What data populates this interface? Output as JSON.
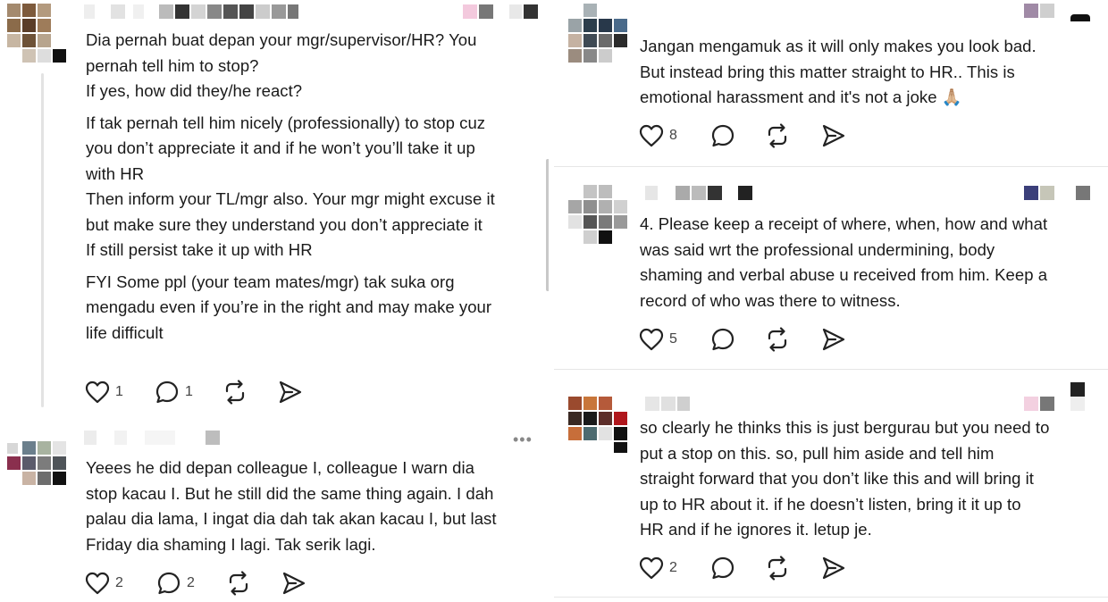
{
  "left": {
    "post1": {
      "lines": [
        "Dia pernah buat depan your mgr/supervisor/HR? You",
        "pernah tell him to stop?",
        "If yes, how did they/he react?",
        "If tak pernah tell him nicely (professionally) to stop cuz",
        "you don’t appreciate it and if he won’t you’ll take it up",
        "with HR",
        "Then inform your TL/mgr also. Your mgr might excuse it",
        "but make sure they understand you don’t appreciate it",
        "If still persist take it up with HR",
        "FYI Some ppl (your team mates/mgr) tak suka org",
        "mengadu even if you’re in the right and may make your",
        "life difficult"
      ],
      "likes": "1",
      "replies": "1"
    },
    "post2": {
      "more": "•••",
      "lines": [
        "Yeees he did depan colleague I, colleague I warn dia",
        "stop kacau I. But he still did the same thing again.  I dah",
        "palau dia lama, I ingat dia dah tak akan kacau I, but last",
        "Friday dia shaming I lagi. Tak serik lagi."
      ],
      "likes": "2",
      "replies": "2"
    }
  },
  "right": {
    "post1": {
      "lines": [
        "Jangan mengamuk as it will only makes you look bad.",
        "But instead bring this matter straight to HR.. This is",
        "emotional harassment and it's not a joke 🙏🏼"
      ],
      "likes": "8"
    },
    "post2": {
      "lines": [
        "4. Please keep a receipt of where, when, how and what",
        "was said wrt the professional undermining, body",
        "shaming and verbal abuse u received from him. Keep a",
        "record of who was there to witness."
      ],
      "likes": "5"
    },
    "post3": {
      "lines": [
        "so clearly he thinks this is just bergurau but you need to",
        "put a stop on this. so, pull him aside and tell him",
        "straight forward that you don’t like this and will bring it",
        "up to HR about it. if he doesn’t listen, bring it it up to",
        "HR and if he ignores it. letup je."
      ],
      "likes": "2"
    }
  },
  "icons": {
    "like": "heart-icon",
    "reply": "comment-bubble-icon",
    "repost": "repost-icon",
    "share": "send-icon"
  },
  "colors": {
    "text": "#1a1a1a",
    "icon": "#222222",
    "divider": "#e6e6e6"
  }
}
